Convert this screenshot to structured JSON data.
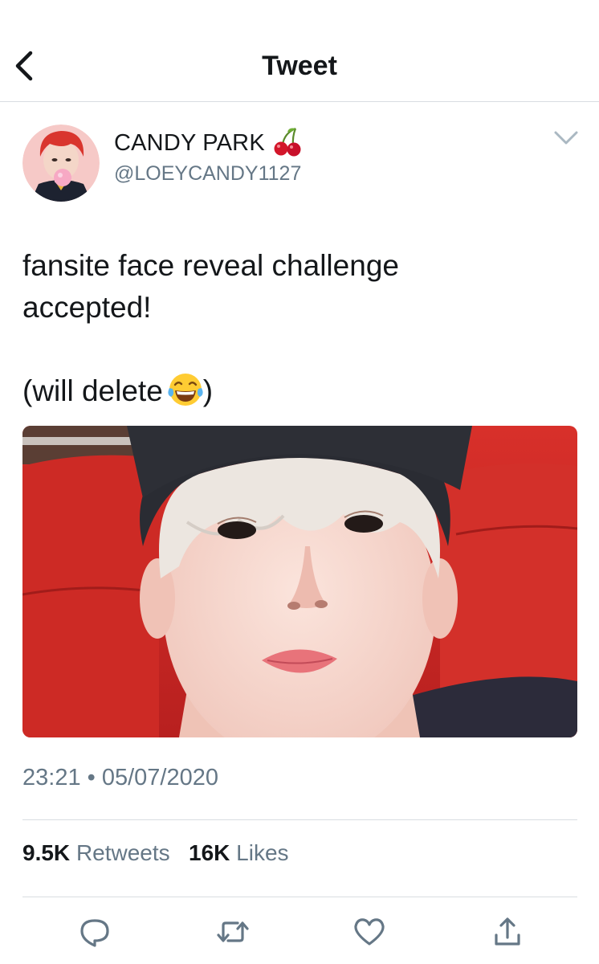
{
  "header": {
    "title": "Tweet"
  },
  "user": {
    "display_name": "CANDY PARK",
    "handle": "@LOEYCANDY1127"
  },
  "tweet": {
    "line1": "fansite face reveal challenge",
    "line2": "accepted!",
    "line3": "(will delete",
    "line3_end": ")",
    "emoji": "face-with-tears-of-joy"
  },
  "meta": {
    "time": "23:21",
    "separator": "•",
    "date": "05/07/2020"
  },
  "stats": {
    "retweets_count": "9.5K",
    "retweets_label": "Retweets",
    "likes_count": "16K",
    "likes_label": "Likes"
  },
  "icons": {
    "back": "chevron-left-icon",
    "more": "chevron-down-icon",
    "reply": "reply-icon",
    "retweet": "retweet-icon",
    "like": "heart-icon",
    "share": "share-icon"
  },
  "colors": {
    "text": "#14171a",
    "secondary": "#657786",
    "divider": "#d9dde1",
    "action_icon": "#1da1f2"
  }
}
